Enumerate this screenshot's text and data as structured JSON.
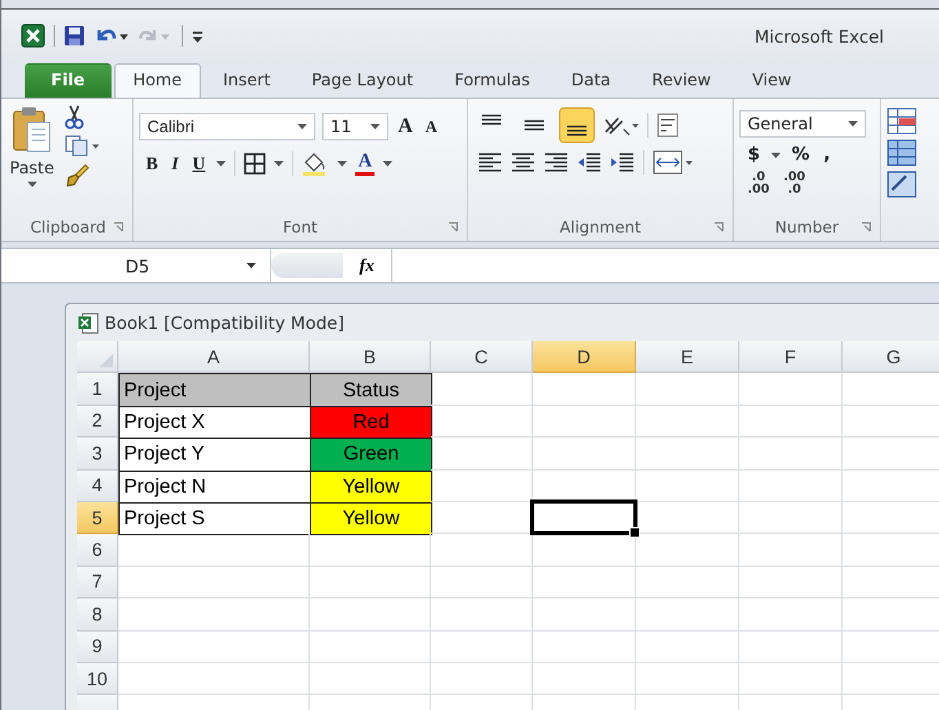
{
  "window": {
    "title": "Microsoft Excel"
  },
  "ribbon_tabs": [
    {
      "label": "File",
      "kind": "file",
      "selected": false
    },
    {
      "label": "Home",
      "kind": "tab",
      "selected": true
    },
    {
      "label": "Insert",
      "kind": "tab",
      "selected": false
    },
    {
      "label": "Page Layout",
      "kind": "tab",
      "selected": false
    },
    {
      "label": "Formulas",
      "kind": "tab",
      "selected": false
    },
    {
      "label": "Data",
      "kind": "tab",
      "selected": false
    },
    {
      "label": "Review",
      "kind": "tab",
      "selected": false
    },
    {
      "label": "View",
      "kind": "tab",
      "selected": false
    }
  ],
  "clipboard": {
    "label": "Clipboard",
    "paste_label": "Paste"
  },
  "font": {
    "label": "Font",
    "font_name": "Calibri",
    "font_size": "11",
    "grow_glyph": "A",
    "shrink_glyph": "A",
    "format_buttons": [
      "B",
      "I",
      "U"
    ],
    "font_color_glyph": "A"
  },
  "alignment": {
    "label": "Alignment",
    "vertical_buttons": [
      {
        "selected": false
      },
      {
        "selected": false
      },
      {
        "selected": true
      }
    ]
  },
  "number": {
    "label": "Number",
    "format": "General",
    "symbols": [
      "$",
      "%",
      ","
    ],
    "decimal_buttons": [
      {
        "top": ".0",
        "bottom": ".00"
      },
      {
        "top": ".00",
        "bottom": ".0"
      }
    ]
  },
  "formula_bar": {
    "name_box": "D5",
    "function_label": "fx"
  },
  "workbook": {
    "title": "Book1  [Compatibility Mode]",
    "columns": [
      {
        "label": "A",
        "selected": false
      },
      {
        "label": "B",
        "selected": false
      },
      {
        "label": "C",
        "selected": false
      },
      {
        "label": "D",
        "selected": true
      },
      {
        "label": "E",
        "selected": false
      },
      {
        "label": "F",
        "selected": false
      },
      {
        "label": "G",
        "selected": false
      }
    ],
    "rows": [
      {
        "number": "1",
        "selected": false,
        "cells": [
          {
            "text": "Project",
            "color": "#bfbfbf"
          },
          {
            "text": "Status",
            "color": "#bfbfbf"
          }
        ]
      },
      {
        "number": "2",
        "selected": false,
        "cells": [
          {
            "text": "Project X",
            "color": "#ffffff"
          },
          {
            "text": "Red",
            "color": "#ff0000"
          }
        ]
      },
      {
        "number": "3",
        "selected": false,
        "cells": [
          {
            "text": "Project Y",
            "color": "#ffffff"
          },
          {
            "text": "Green",
            "color": "#00b050"
          }
        ]
      },
      {
        "number": "4",
        "selected": false,
        "cells": [
          {
            "text": "Project N",
            "color": "#ffffff"
          },
          {
            "text": "Yellow",
            "color": "#ffff00"
          }
        ]
      },
      {
        "number": "5",
        "selected": true,
        "cells": [
          {
            "text": "Project S",
            "color": "#ffffff"
          },
          {
            "text": "Yellow",
            "color": "#ffff00"
          }
        ]
      },
      {
        "number": "6",
        "selected": false,
        "cells": []
      },
      {
        "number": "7",
        "selected": false,
        "cells": []
      },
      {
        "number": "8",
        "selected": false,
        "cells": []
      },
      {
        "number": "9",
        "selected": false,
        "cells": []
      },
      {
        "number": "10",
        "selected": false,
        "cells": []
      }
    ]
  }
}
